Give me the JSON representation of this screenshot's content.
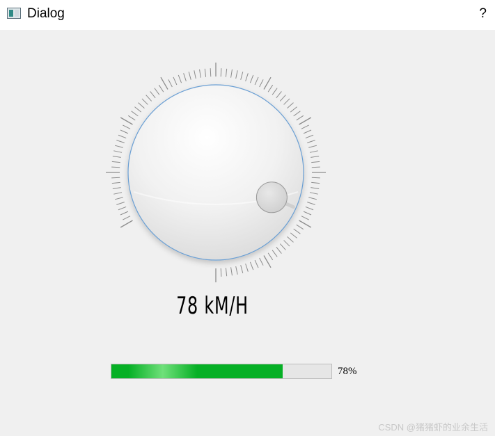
{
  "window": {
    "title": "Dialog",
    "help_label": "?"
  },
  "dial": {
    "value": 78,
    "min": 0,
    "max": 100,
    "display_text": "78 kM/H"
  },
  "progress": {
    "value": 78,
    "text": "78%",
    "fill_color": "#06b025",
    "track_color": "#e6e6e6"
  },
  "watermark": "CSDN @猪猪虾的业余生活",
  "colors": {
    "background": "#f0f0f0",
    "dial_border": "#6a9fd4",
    "tick": "#8c8c8c"
  }
}
